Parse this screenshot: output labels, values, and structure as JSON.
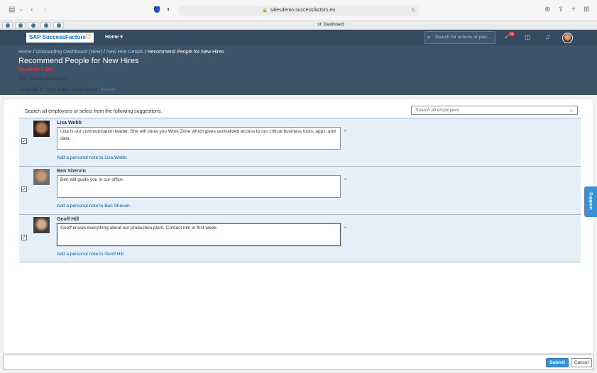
{
  "browser": {
    "url": "salesdemo.successfactors.eu",
    "tab_title": "Dashboard",
    "tab_prefix": "sf"
  },
  "shell": {
    "logo_text": "SAP SuccessFactors",
    "home_label": "Home ▾",
    "search_placeholder": "Search for actions or peo...",
    "notification_count": "18"
  },
  "banner": {
    "breadcrumb": {
      "home": "Home",
      "onboarding": "Onboarding Dashboard (New)",
      "hire_details": "New Hire Details",
      "current": "Recommend People for New Hires"
    },
    "sep": " / ",
    "title": "Recommend People for New Hires",
    "deadline": "Deadline: 1 day",
    "for_line": "For: Thomas Schneider",
    "assigned": "Assigned To: Jada Baker, Adam Novak,",
    "more": "3 more"
  },
  "main": {
    "intro": "Search all employees or select from the following suggestions.",
    "search_placeholder": "Search all employees",
    "required_mark": "*",
    "people": [
      {
        "name": "Lisa Webb",
        "note": "Lisa is our communication leader. She will show you Work Zone which gives centralized access to our critical business tools, apps, and data.",
        "add_note": "Add a personal note to Lisa Webb."
      },
      {
        "name": "Ben Shervin",
        "note": "Ben will guide you in our office.",
        "add_note": "Add a personal note to Ben Shervin."
      },
      {
        "name": "Geoff Hill",
        "note": "Geoff knows everything about our production plant. Contact him in first week.",
        "add_note": "Add a personal note to Geoff Hill."
      }
    ]
  },
  "support_label": "Support",
  "footer": {
    "submit": "Submit",
    "cancel": "Cancel"
  }
}
